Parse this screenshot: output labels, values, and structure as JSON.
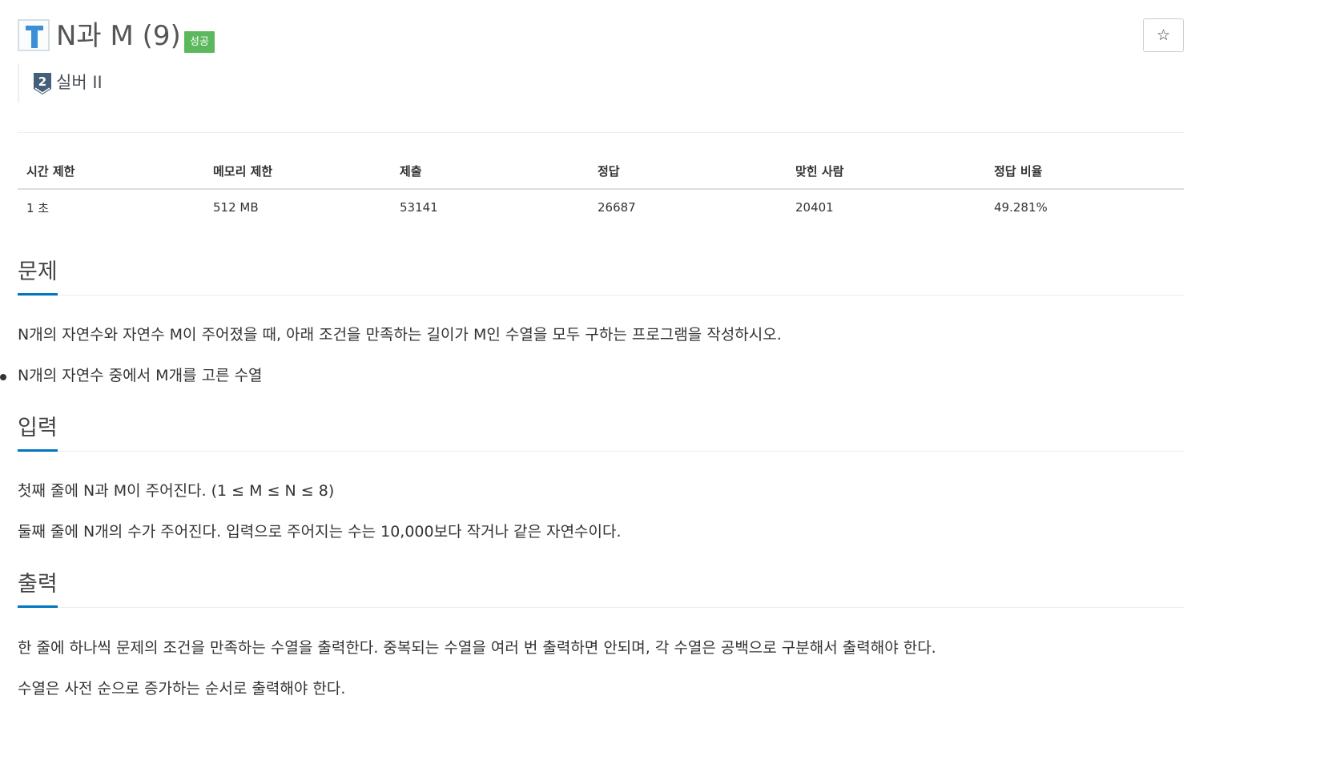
{
  "header": {
    "title": "N과 M (9)",
    "status_badge": "성공",
    "tier_level": "2",
    "tier_label": "실버 II",
    "star_icon": "☆"
  },
  "info_table": {
    "headers": [
      "시간 제한",
      "메모리 제한",
      "제출",
      "정답",
      "맞힌 사람",
      "정답 비율"
    ],
    "values": [
      "1 초",
      "512 MB",
      "53141",
      "26687",
      "20401",
      "49.281%"
    ]
  },
  "problem": {
    "heading": "문제",
    "description": "N개의 자연수와 자연수 M이 주어졌을 때, 아래 조건을 만족하는 길이가 M인 수열을 모두 구하는 프로그램을 작성하시오.",
    "conditions": [
      "N개의 자연수 중에서 M개를 고른 수열"
    ]
  },
  "input": {
    "heading": "입력",
    "lines": [
      "첫째 줄에 N과 M이 주어진다. (1 ≤ M ≤ N ≤ 8)",
      "둘째 줄에 N개의 수가 주어진다. 입력으로 주어지는 수는 10,000보다 작거나 같은 자연수이다."
    ]
  },
  "output": {
    "heading": "출력",
    "lines": [
      "한 줄에 하나씩 문제의 조건을 만족하는 수열을 출력한다. 중복되는 수열을 여러 번 출력하면 안되며, 각 수열은 공백으로 구분해서 출력해야 한다.",
      "수열은 사전 순으로 증가하는 순서로 출력해야 한다."
    ]
  },
  "colors": {
    "badge_success": "#5cb85c",
    "accent_underline": "#0076c0",
    "logo_blue": "#3a8fd6",
    "tier_silver": "#435f7a"
  },
  "icons": {
    "logo": "t-logo-icon",
    "star": "star-icon",
    "tier": "silver-tier-icon"
  }
}
